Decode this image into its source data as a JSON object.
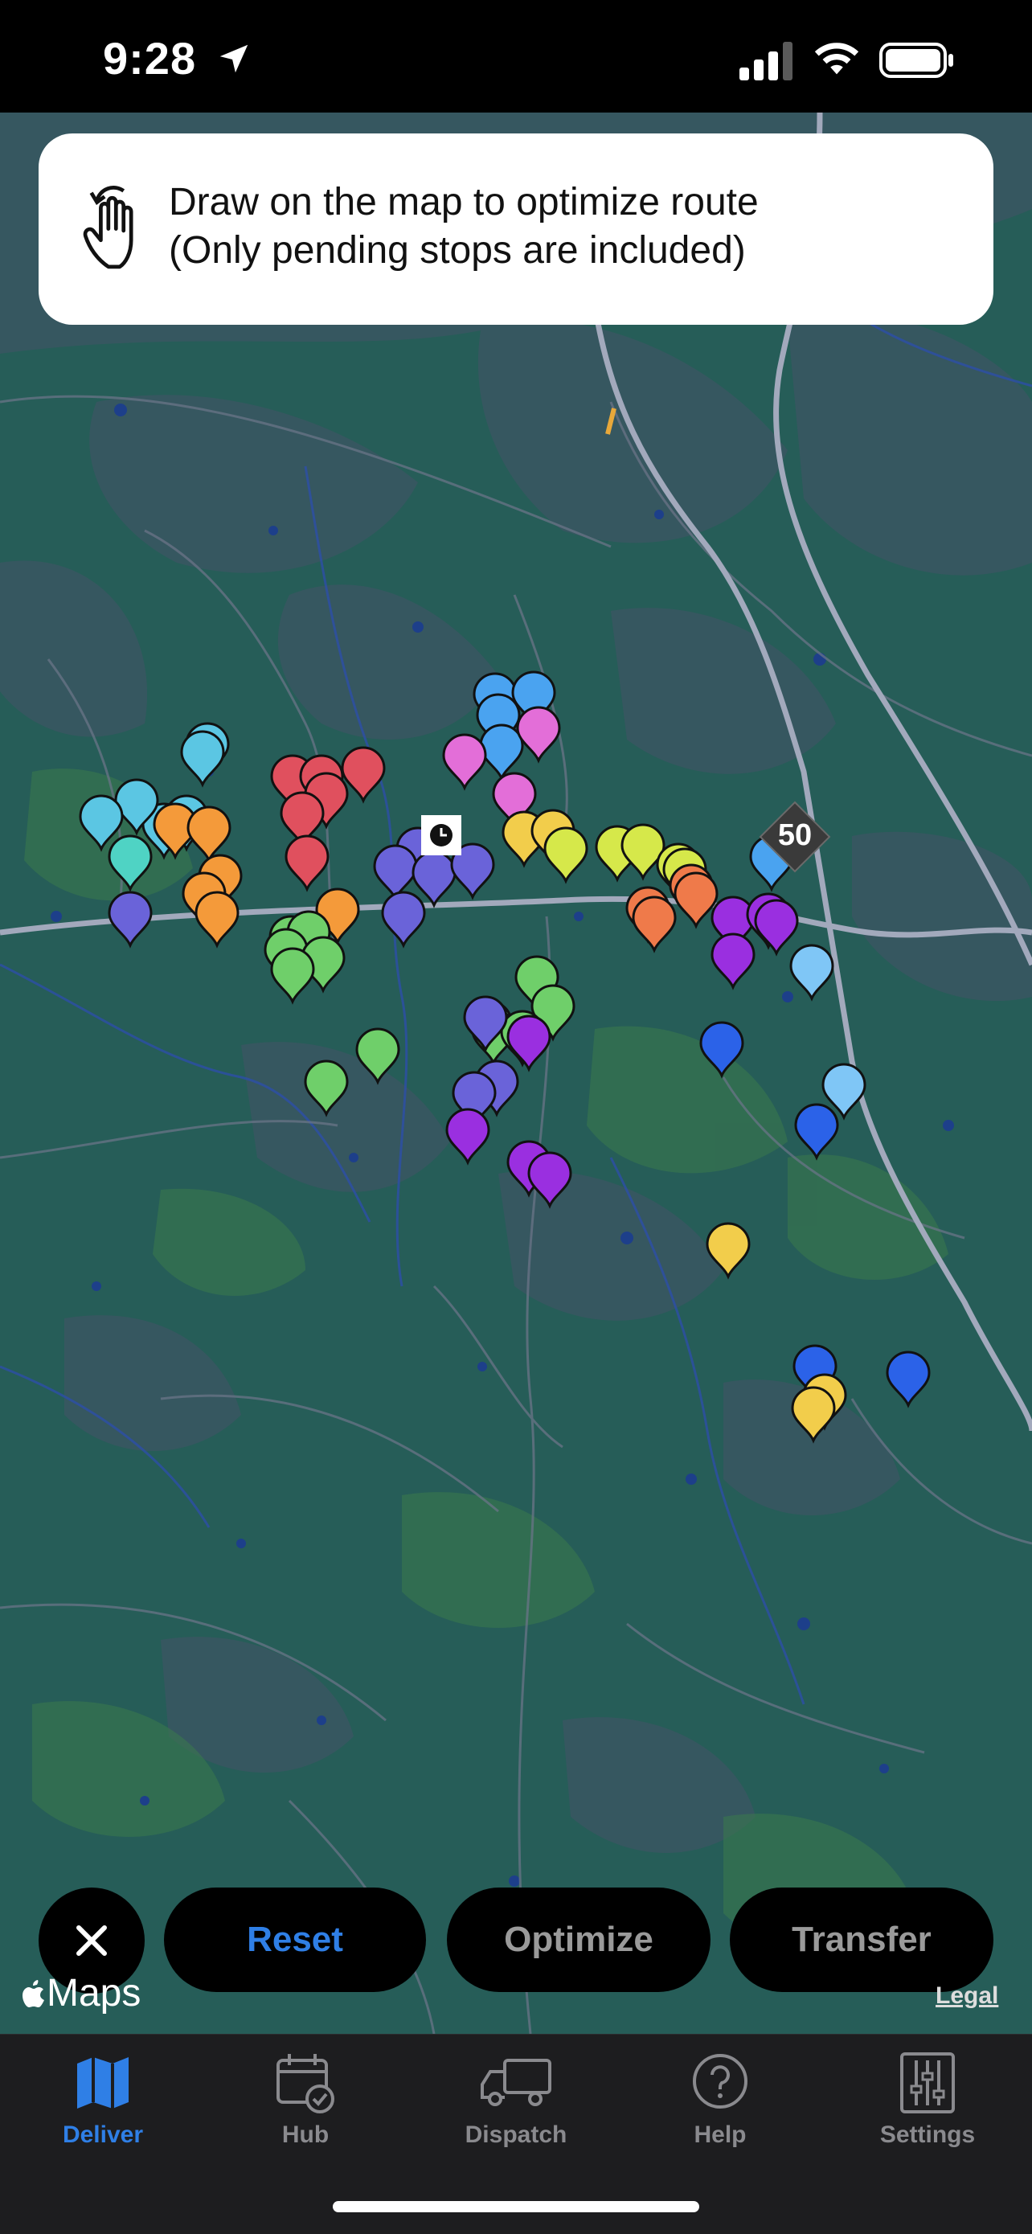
{
  "status_bar": {
    "time": "9:28",
    "icons": [
      "location-arrow-icon",
      "cellular-signal-icon",
      "wifi-icon",
      "battery-icon"
    ]
  },
  "banner": {
    "icon": "hand-draw-icon",
    "line1": "Draw on the map to optimize route",
    "line2": "(Only pending stops are included)"
  },
  "map": {
    "highway_shield": "50",
    "attribution": "Maps",
    "legal": "Legal"
  },
  "actions": {
    "close_icon": "close-icon",
    "reset": "Reset",
    "optimize": "Optimize",
    "transfer": "Transfer",
    "accent": "#2f7fe6"
  },
  "tabs": [
    {
      "label": "Deliver",
      "icon": "map-icon",
      "active": true
    },
    {
      "label": "Hub",
      "icon": "calendar-check-icon",
      "active": false
    },
    {
      "label": "Dispatch",
      "icon": "truck-icon",
      "active": false
    },
    {
      "label": "Help",
      "icon": "question-circle-icon",
      "active": false
    },
    {
      "label": "Settings",
      "icon": "sliders-icon",
      "active": false
    }
  ],
  "pin_colors": {
    "cyan": "#5bc6e3",
    "red": "#e0505e",
    "orange": "#f49a3a",
    "teal": "#4fd3c4",
    "indigo": "#6a63d9",
    "green": "#6fcf6a",
    "magenta": "#e36ed8",
    "sky": "#4aa3f0",
    "yellow": "#f2cd4b",
    "lime": "#d6e84a",
    "coral": "#ef7a4a",
    "purple": "#9a2fe0",
    "lightblue": "#7fc6f6",
    "blue": "#2b62e8"
  }
}
